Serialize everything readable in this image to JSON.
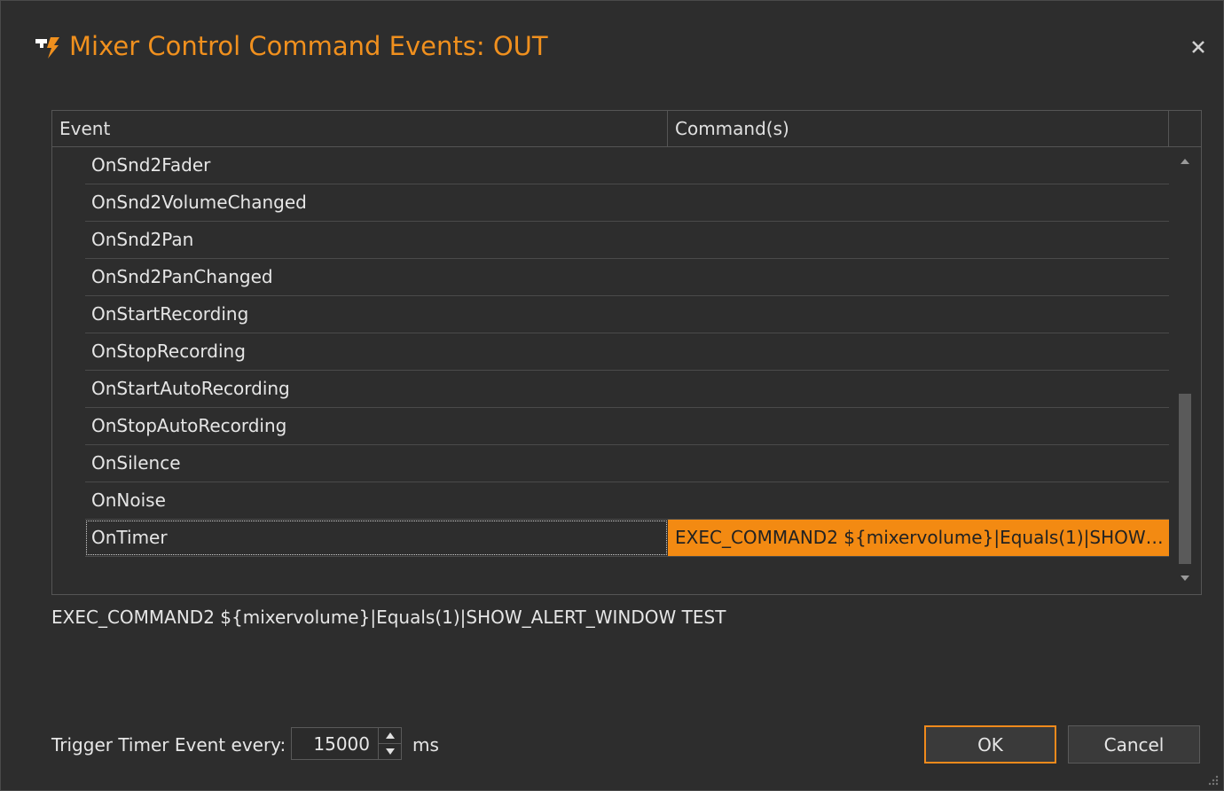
{
  "window": {
    "title": "Mixer Control Command Events: OUT"
  },
  "grid": {
    "columns": [
      "Event",
      "Command(s)"
    ],
    "rows": [
      {
        "event": "OnSnd2Fader",
        "command": ""
      },
      {
        "event": "OnSnd2VolumeChanged",
        "command": ""
      },
      {
        "event": "OnSnd2Pan",
        "command": ""
      },
      {
        "event": "OnSnd2PanChanged",
        "command": ""
      },
      {
        "event": "OnStartRecording",
        "command": ""
      },
      {
        "event": "OnStopRecording",
        "command": ""
      },
      {
        "event": "OnStartAutoRecording",
        "command": ""
      },
      {
        "event": "OnStopAutoRecording",
        "command": ""
      },
      {
        "event": "OnSilence",
        "command": ""
      },
      {
        "event": "OnNoise",
        "command": ""
      },
      {
        "event": "OnTimer",
        "command": "EXEC_COMMAND2 ${mixervolume}|Equals(1)|SHOW_A..."
      }
    ]
  },
  "preview_text": "EXEC_COMMAND2 ${mixervolume}|Equals(1)|SHOW_ALERT_WINDOW TEST",
  "timer": {
    "label": "Trigger Timer Event every:",
    "value": "15000",
    "unit": "ms"
  },
  "buttons": {
    "ok": "OK",
    "cancel": "Cancel"
  },
  "colors": {
    "accent": "#f0901e",
    "selection": "#f38a12",
    "background": "#2d2d2d"
  }
}
